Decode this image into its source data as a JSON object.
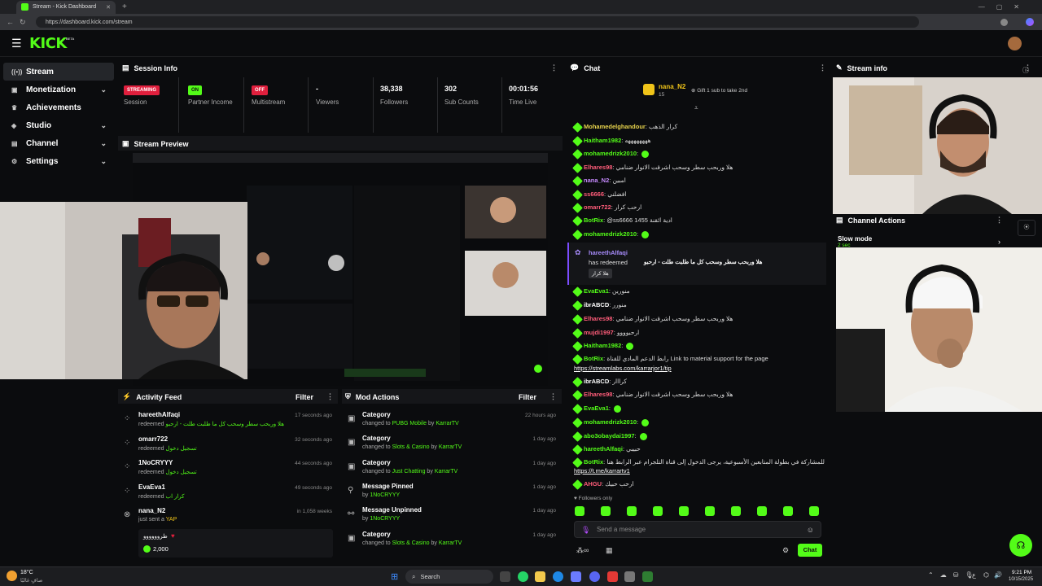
{
  "browser": {
    "tab_title": "Stream - Kick Dashboard",
    "url": "https://dashboard.kick.com/stream"
  },
  "brand": {
    "logo": "KICK",
    "logo_sup": "BETA",
    "accent": "#53fc18"
  },
  "sidebar": {
    "items": [
      {
        "label": "Stream",
        "icon": "broadcast-icon"
      },
      {
        "label": "Monetization",
        "icon": "money-icon"
      },
      {
        "label": "Achievements",
        "icon": "trophy-icon"
      },
      {
        "label": "Studio",
        "icon": "studio-icon"
      },
      {
        "label": "Channel",
        "icon": "channel-icon"
      },
      {
        "label": "Settings",
        "icon": "gear-icon"
      }
    ]
  },
  "session_info": {
    "title": "Session Info",
    "stats": [
      {
        "badge": "STREAMING",
        "label": "Session"
      },
      {
        "badge": "ON",
        "label": "Partner Income"
      },
      {
        "badge": "OFF",
        "label": "Multistream"
      },
      {
        "value": "-",
        "label": "Viewers"
      },
      {
        "value": "38,338",
        "label": "Followers"
      },
      {
        "value": "302",
        "label": "Sub Counts"
      },
      {
        "value": "00:01:56",
        "label": "Time Live"
      }
    ]
  },
  "stream_preview": {
    "title": "Stream Preview"
  },
  "activity_feed": {
    "title": "Activity Feed",
    "filter": "Filter",
    "items": [
      {
        "name": "hareethAlfaqi",
        "sub": "redeemed",
        "detail": "هلا وربحب سطر وسحب كل ما طلبت طلت - ارحبو",
        "time": "17 seconds ago"
      },
      {
        "name": "omarr722",
        "sub": "redeemed",
        "detail": "تسجيل دخول",
        "time": "32 seconds ago"
      },
      {
        "name": "1NoCRYYY",
        "sub": "redeemed",
        "detail": "تسجيل دخول",
        "time": "44 seconds ago"
      },
      {
        "name": "EvaEva1",
        "sub": "redeemed",
        "detail": "كرار اب",
        "time": "49 seconds ago"
      },
      {
        "name": "nana_N2",
        "sub": "just sent a",
        "detail": "YAP",
        "time": "in 1,058 weeks",
        "message": "طروووووو",
        "amount": "2,000"
      }
    ]
  },
  "mod_actions": {
    "title": "Mod Actions",
    "filter": "Filter",
    "items": [
      {
        "action": "Category",
        "sub": "changed to",
        "target": "PUBG Mobile",
        "by": "by",
        "who": "KarrarTV",
        "time": "22 hours ago"
      },
      {
        "action": "Category",
        "sub": "changed to",
        "target": "Slots & Casino",
        "by": "by",
        "who": "KarrarTV",
        "time": "1 day ago"
      },
      {
        "action": "Category",
        "sub": "changed to",
        "target": "Just Chatting",
        "by": "by",
        "who": "KarrarTV",
        "time": "1 day ago"
      },
      {
        "action": "Message Pinned",
        "sub": "by",
        "target": "1NoCRYYY",
        "by": "",
        "who": "",
        "time": "1 day ago"
      },
      {
        "action": "Message Unpinned",
        "sub": "by",
        "target": "1NoCRYYY",
        "by": "",
        "who": "",
        "time": "1 day ago"
      },
      {
        "action": "Category",
        "sub": "changed to",
        "target": "Slots & Casino",
        "by": "by",
        "who": "KarrarTV",
        "time": "1 day ago"
      }
    ]
  },
  "chat": {
    "title": "Chat",
    "pinned_user": "nana_N2",
    "pinned_count": "15",
    "gift_text": "Gift 1 sub to take 2nd",
    "lines": [
      {
        "user": "Mohamedelghandour",
        "color": "#e8d44d",
        "text": "كرار الذهب"
      },
      {
        "user": "Haitham1982",
        "color": "#53fc18",
        "text": "ههههههههه"
      },
      {
        "user": "mohamedrizk2010",
        "color": "#53fc18",
        "text": ""
      },
      {
        "user": "Elhares98",
        "color": "#ff5d7a",
        "text": "هلا وربحب سطر وسحب اشرقت الانوار ضنامي"
      },
      {
        "user": "nana_N2",
        "color": "#c78bff",
        "text": "امبين"
      },
      {
        "user": "ss6666",
        "color": "#ff5d7a",
        "text": "افضلني"
      },
      {
        "user": "omarr722",
        "color": "#ff5d7a",
        "text": "ارحب كرار"
      },
      {
        "user": "BotRix",
        "color": "#53fc18",
        "text": "@ss6666 1455 ادية ائقنة"
      },
      {
        "user": "mohamedrizk2010",
        "color": "#53fc18",
        "text": ""
      },
      {
        "user": "EvaEva1",
        "color": "#53fc18",
        "text": "منورين"
      },
      {
        "user": "ibrABCD",
        "color": "#ffffff",
        "text": "منورر"
      },
      {
        "user": "Elhares98",
        "color": "#ff5d7a",
        "text": "هلا وربحب سطر وسحب اشرقت الانوار ضنامي"
      },
      {
        "user": "mujdi1997",
        "color": "#ff5d7a",
        "text": "ارحبوووو"
      },
      {
        "user": "Haitham1982",
        "color": "#53fc18",
        "text": ""
      },
      {
        "user": "BotRix",
        "color": "#53fc18",
        "text": "رابط الدعم المادي للقناة Link to material support for the page"
      },
      {
        "user": "",
        "color": "#ffffff",
        "text": "https://streamlabs.com/karrarjor1/tip"
      },
      {
        "user": "ibrABCD",
        "color": "#ffffff",
        "text": "كرااار"
      },
      {
        "user": "Elhares98",
        "color": "#ff5d7a",
        "text": "هلا وربحب سطر وسحب اشرقت الانوار ضنامي"
      },
      {
        "user": "EvaEva1",
        "color": "#53fc18",
        "text": ""
      },
      {
        "user": "mohamedrizk2010",
        "color": "#53fc18",
        "text": ""
      },
      {
        "user": "abo3obaydai1997",
        "color": "#53fc18",
        "text": ""
      },
      {
        "user": "hareethAlfaqi",
        "color": "#53fc18",
        "text": "حبيبي"
      },
      {
        "user": "BotRix",
        "color": "#53fc18",
        "text": "للمشاركة في بطولة المتابعين الأسبوعية، يرجى الدخول إلى قناة التلجرام عبر الرابط هنا"
      },
      {
        "user": "",
        "color": "#ffffff",
        "text": "https://t.me/karrartv1"
      },
      {
        "user": "AHGU",
        "color": "#ff5d7a",
        "text": "ارحب حبيك"
      }
    ],
    "redeem": {
      "user": "hareethAlfaqi",
      "line1": "has redeemed",
      "reward": "هلا وربحب سطر وسحب كل ما طلبت طلت - ارحبو",
      "tag": "هلا كرار"
    },
    "followers_only": "Followers only",
    "input_placeholder": "Send a message",
    "send_label": "Chat"
  },
  "stream_info": {
    "title": "Stream info"
  },
  "channel_actions": {
    "title": "Channel Actions",
    "slow_mode": "Slow mode",
    "slow_value": "2 sec"
  },
  "taskbar": {
    "weather_temp": "18°C",
    "weather_desc": "صافٍ غالبًا",
    "search": "Search",
    "time": "9:21 PM",
    "date": "10/15/2025",
    "lang": "ع"
  }
}
